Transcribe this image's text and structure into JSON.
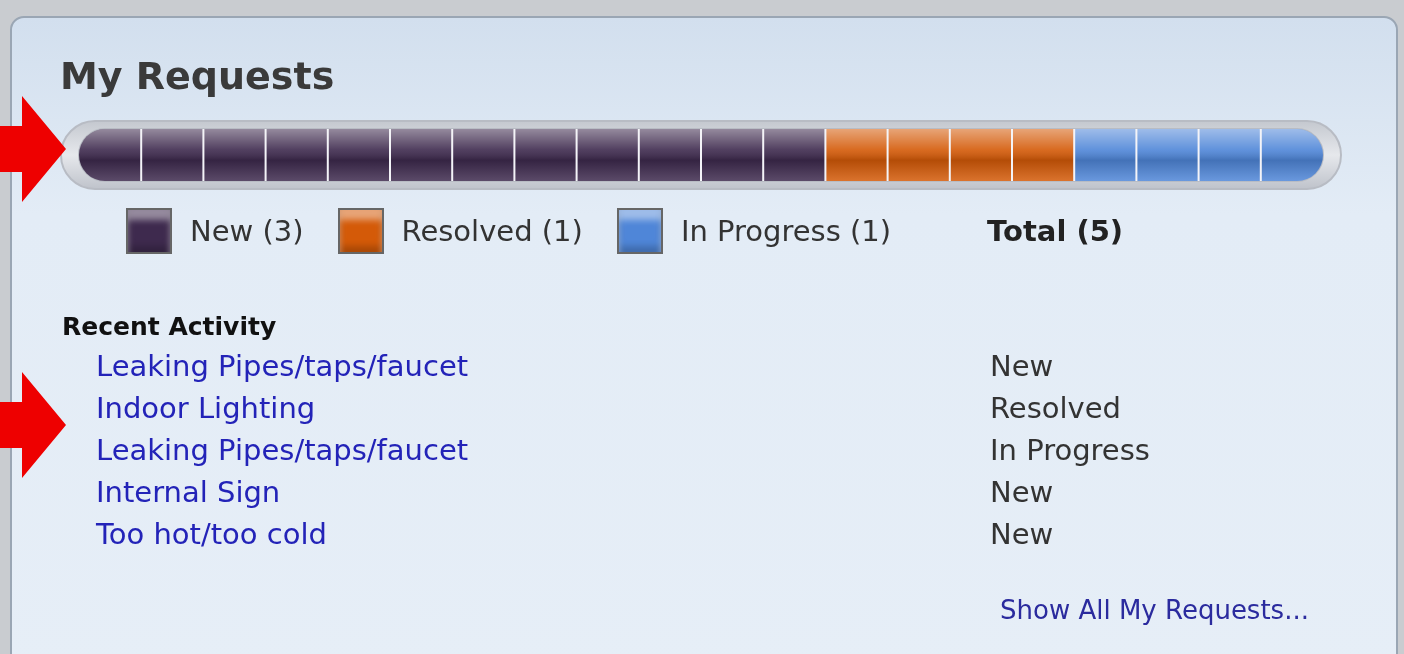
{
  "panel": {
    "title": "My Requests"
  },
  "statuses": [
    {
      "label": "New (3)",
      "color": "#3e2a4e"
    },
    {
      "label": "Resolved (1)",
      "color": "#d45a08"
    },
    {
      "label": "In Progress (1)",
      "color": "#4f86d8"
    }
  ],
  "total": "Total (5)",
  "recent_activity": {
    "heading": "Recent Activity",
    "rows": [
      {
        "title": "Leaking Pipes/taps/faucet",
        "status": "New"
      },
      {
        "title": "Indoor Lighting",
        "status": "Resolved"
      },
      {
        "title": "Leaking Pipes/taps/faucet",
        "status": "In Progress"
      },
      {
        "title": "Internal Sign",
        "status": "New"
      },
      {
        "title": "Too hot/too cold",
        "status": "New"
      }
    ]
  },
  "show_all_link": "Show All My Requests..."
}
